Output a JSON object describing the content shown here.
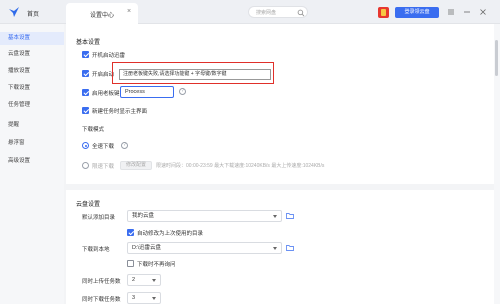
{
  "titlebar": {
    "home_label": "首页",
    "tab_label": "设置中心",
    "search_placeholder": "搜索网盘",
    "vip_button": "登录领云盘"
  },
  "sidebar": {
    "items": [
      {
        "label": "基本设置",
        "active": true
      },
      {
        "label": "云盘设置",
        "active": false
      },
      {
        "label": "播放设置",
        "active": false
      },
      {
        "label": "下载设置",
        "active": false
      },
      {
        "label": "任务管理",
        "active": false
      },
      {
        "label": "提醒",
        "active": false
      },
      {
        "label": "悬浮窗",
        "active": false
      },
      {
        "label": "高级设置",
        "active": false
      }
    ]
  },
  "basic": {
    "title": "基本设置",
    "auto_start": "开机启动迅雷",
    "boss_key_prefix": "开启启动",
    "boss_key_enable": "启用老板键",
    "boss_key_value": "Process",
    "new_task_show": "新建任务时显示主界面",
    "tooltip": "注册老板键失败,请选择功能键 + 字母键/数字键",
    "download_mode_title": "下载模式",
    "full_speed": "全速下载",
    "limited_speed": "限速下载",
    "speed_limit_button": "修改配置",
    "limit_info": "限速时间段：00:00-23:59  最大下载速度:10240KB/s  最大上传速度:1024KB/s"
  },
  "cloud": {
    "title": "云盘设置",
    "default_add_label": "默认添加目录",
    "default_add_value": "我的云盘",
    "auto_modify_label": "自动修改为上次使用的目录",
    "download_to_label": "下载到本地",
    "download_to_value": "D:\\迅雷云盘",
    "no_ask_label": "下载时不再询问",
    "upload_tasks_label": "同时上传任务数",
    "upload_tasks_value": "2",
    "download_tasks_label": "同时下载任务数",
    "download_tasks_value": "3"
  },
  "colors": {
    "accent": "#3a6df0",
    "highlight_box": "#e0302a"
  }
}
